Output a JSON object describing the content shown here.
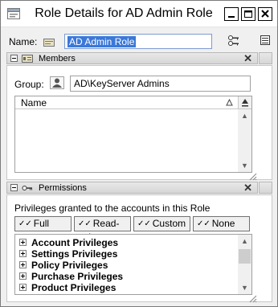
{
  "window": {
    "title": "Role Details for AD Admin Role"
  },
  "name_row": {
    "label": "Name:",
    "value": "AD Admin Role"
  },
  "members": {
    "title": "Members",
    "group_label": "Group:",
    "group_value": "AD\\KeyServer Admins",
    "column_header": "Name"
  },
  "permissions": {
    "title": "Permissions",
    "description": "Privileges granted to the accounts in this Role",
    "buttons": [
      {
        "label": "Full"
      },
      {
        "label": "Read-only"
      },
      {
        "label": "Custom"
      },
      {
        "label": "None"
      }
    ],
    "items": [
      {
        "label": "Account Privileges"
      },
      {
        "label": "Settings Privileges"
      },
      {
        "label": "Policy Privileges"
      },
      {
        "label": "Purchase Privileges"
      },
      {
        "label": "Product Privileges"
      }
    ]
  },
  "icons": {
    "app": "role-icon",
    "name": "role-icon",
    "keys": "keys-icon",
    "menu": "panel-menu-icon",
    "members": "members-icon",
    "permissions": "key-icon",
    "group": "user-icon",
    "minimize": "minimize-icon",
    "maximize": "maximize-icon",
    "close": "close-icon",
    "sort": "sort-icon"
  },
  "colors": {
    "selection": "#3b78d8",
    "window_bg": "#f0f0f0"
  }
}
